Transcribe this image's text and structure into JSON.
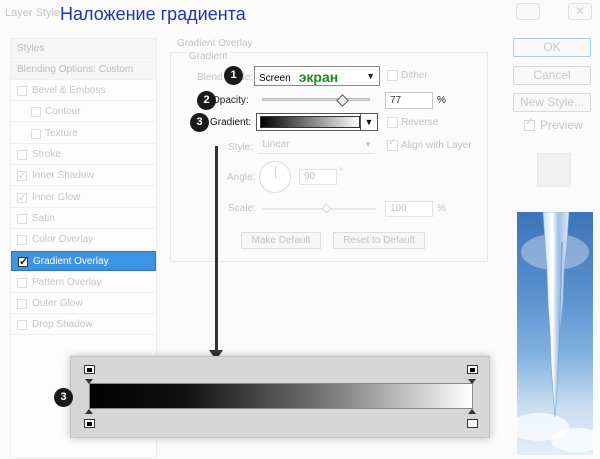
{
  "window": {
    "title": "Layer Style",
    "overlay_title": "Наложение градиента",
    "close_glyph": "✕"
  },
  "styles_list": {
    "header": "Styles",
    "blending": "Blending Options: Custom",
    "items": [
      {
        "label": "Bevel & Emboss",
        "checked": false
      },
      {
        "label": "Contour",
        "checked": false
      },
      {
        "label": "Texture",
        "checked": false
      },
      {
        "label": "Stroke",
        "checked": false
      },
      {
        "label": "Inner Shadow",
        "checked": true
      },
      {
        "label": "Inner Glow",
        "checked": true
      },
      {
        "label": "Satin",
        "checked": false
      },
      {
        "label": "Color Overlay",
        "checked": false
      },
      {
        "label": "Gradient Overlay",
        "checked": true,
        "active": true
      },
      {
        "label": "Pattern Overlay",
        "checked": false
      },
      {
        "label": "Outer Glow",
        "checked": false
      },
      {
        "label": "Drop Shadow",
        "checked": false
      }
    ]
  },
  "buttons": {
    "ok": "OK",
    "cancel": "Cancel",
    "new_style": "New Style...",
    "preview": "Preview",
    "preview_checked": true
  },
  "panel": {
    "section_title": "Gradient Overlay",
    "group_title": "Gradient",
    "blend_mode": {
      "label": "Blend Mode:",
      "value": "Screen",
      "overlay_label": "экран"
    },
    "dither": {
      "label": "Dither",
      "checked": false
    },
    "opacity": {
      "label": "Opacity:",
      "value": "77",
      "unit": "%",
      "level": 0.77
    },
    "gradient": {
      "label": "Gradient:",
      "from": "#000000",
      "to": "#ffffff"
    },
    "reverse": {
      "label": "Reverse",
      "checked": false
    },
    "style": {
      "label": "Style:",
      "value": "Linear"
    },
    "align": {
      "label": "Align with Layer",
      "checked": true
    },
    "angle": {
      "label": "Angle:",
      "value": "90",
      "unit": "°"
    },
    "scale": {
      "label": "Scale:",
      "value": "100",
      "unit": "%"
    },
    "make_default": "Make Default",
    "reset_default": "Reset to Default"
  },
  "steps": {
    "one": "1",
    "two": "2",
    "three": "3",
    "three_b": "3"
  },
  "gradient_editor": {
    "colors": [
      "#000000",
      "#ffffff"
    ],
    "opacity_stops": [
      "#000000",
      "#000000"
    ],
    "color_stops": [
      "#000000",
      "#ffffff"
    ]
  }
}
